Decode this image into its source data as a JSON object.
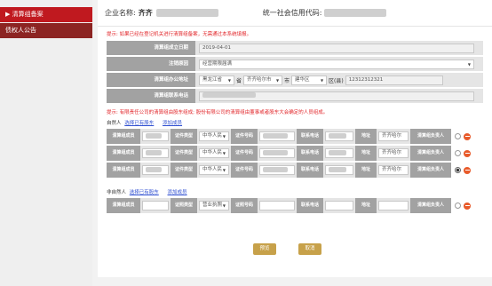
{
  "sidebar": {
    "items": [
      {
        "label": "▶ 清算组备案"
      },
      {
        "label": "债权人公告"
      }
    ]
  },
  "header": {
    "company_label": "企业名称:",
    "company_value": "齐齐",
    "credit_label": "统一社会信用代码:"
  },
  "tip1": "提示: 如果已经在登记机关进行清算组备案，无需通过本系统填报。",
  "form": {
    "date_label": "清算组成立日期",
    "date_value": "2019-04-01",
    "reason_label": "注销原因",
    "reason_value": "经营期限届满",
    "address_label": "清算组办公地址",
    "province": "黑龙江省",
    "province_suffix": "省",
    "city": "齐齐哈尔市",
    "city_suffix": "市",
    "district": "建华区",
    "district_suffix": "区(县)",
    "detail": "12312312321",
    "phone_label": "清算组联系电话"
  },
  "tip2": "提示: 有限责任公司的清算组由股东组成; 股份有限公司的清算组由董事或者股东大会确定的人员组成。",
  "natural": {
    "title": "自然人",
    "select_link": "选择已有股东",
    "add_link": "添加成员",
    "rows": [
      {
        "member_label": "清算组成员",
        "cert_type_label": "证件类型",
        "cert_type": "中华人民",
        "cert_no_label": "证件号码",
        "phone_label": "联系电话",
        "addr_label": "地址",
        "addr": "齐齐哈尔",
        "leader_label": "清算组负责人"
      },
      {
        "member_label": "清算组成员",
        "cert_type_label": "证件类型",
        "cert_type": "中华人民",
        "cert_no_label": "证件号码",
        "phone_label": "联系电话",
        "addr_label": "地址",
        "addr": "齐齐哈尔",
        "leader_label": "清算组负责人"
      },
      {
        "member_label": "清算组成员",
        "cert_type_label": "证件类型",
        "cert_type": "中华人民",
        "cert_no_label": "证件号码",
        "phone_label": "联系电话",
        "addr_label": "地址",
        "addr": "齐齐哈尔",
        "leader_label": "清算组负责人"
      }
    ]
  },
  "nonnatural": {
    "title": "非自然人",
    "select_link": "选择已有股东",
    "add_link": "添加成员",
    "row": {
      "member_label": "清算组成员",
      "cert_type_label": "证照类型",
      "cert_type": "营业执照",
      "cert_no_label": "证照号码",
      "phone_label": "联系电话",
      "addr_label": "地址",
      "leader_label": "清算组负责人"
    }
  },
  "buttons": {
    "preview": "预览",
    "cancel": "取消"
  }
}
